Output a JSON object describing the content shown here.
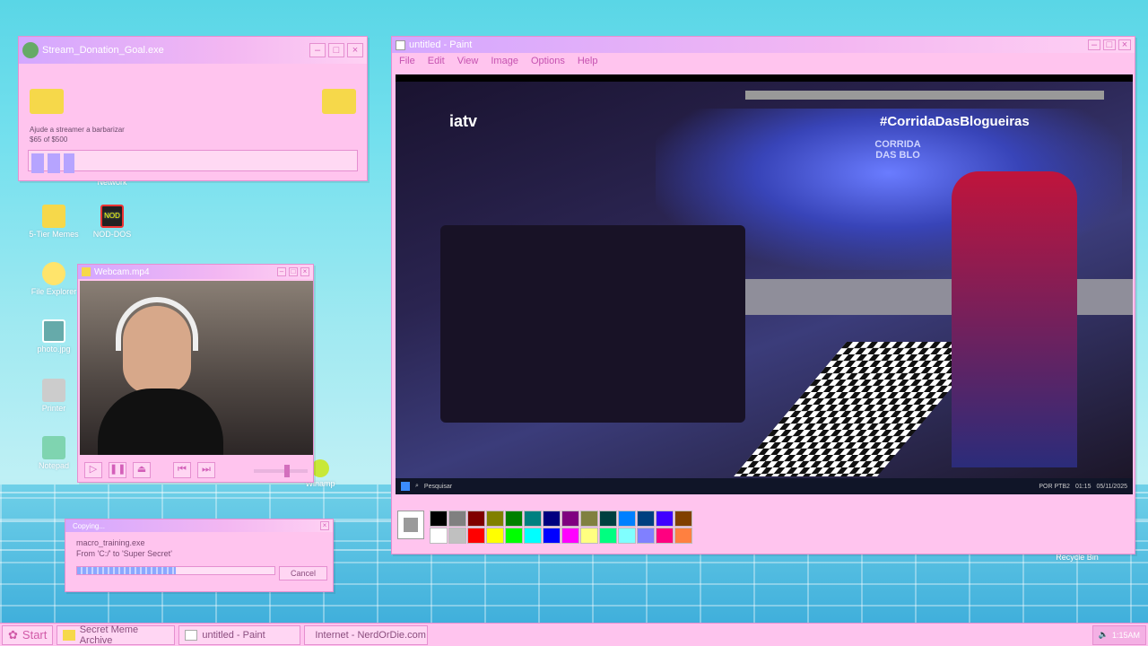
{
  "donation_window": {
    "title": "Stream_Donation_Goal.exe",
    "text": "Ajude a streamer a barbarizar",
    "amount": "$65 of $500",
    "progress": 0.13
  },
  "desktop_icons": [
    {
      "label": "Network",
      "icon": "network-icon"
    },
    {
      "label": "5-Tier Memes",
      "icon": "folder-icon"
    },
    {
      "label": "NOD-DOS",
      "icon": "nod-icon"
    },
    {
      "label": "File Explorer",
      "icon": "magnifier-icon"
    },
    {
      "label": "photo.jpg",
      "icon": "photo-icon"
    },
    {
      "label": "Printer",
      "icon": "printer-icon"
    },
    {
      "label": "Notepad",
      "icon": "notepad-icon"
    },
    {
      "label": "Winamp",
      "icon": "winamp-icon"
    },
    {
      "label": "Recycle Bin",
      "icon": "recycle-bin-icon"
    }
  ],
  "webcam_window": {
    "title": "Webcam.mp4",
    "controls": [
      "play",
      "pause",
      "eject",
      "previous",
      "next"
    ]
  },
  "copy_dialog": {
    "title": "Copying...",
    "file": "macro_training.exe",
    "from_to": "From 'C:/' to 'Super Secret'",
    "progress": 0.5,
    "cancel_label": "Cancel"
  },
  "paint_window": {
    "title": "untitled - Paint",
    "menu": [
      "File",
      "Edit",
      "View",
      "Image",
      "Options",
      "Help"
    ],
    "stream": {
      "channel_logo": "iatv",
      "hashtag": "#CorridaDasBlogueiras",
      "show_logo": "CORRIDA DAS BLO",
      "search_label": "Pesquisar",
      "clock_time": "01:15",
      "clock_date": "05/11/2025",
      "lang": "POR PTB2"
    },
    "palette_row1": [
      "#000000",
      "#808080",
      "#800000",
      "#808000",
      "#008000",
      "#008080",
      "#000080",
      "#800080",
      "#808040",
      "#004040",
      "#0080ff",
      "#004080",
      "#4000ff",
      "#804000"
    ],
    "palette_row2": [
      "#ffffff",
      "#c0c0c0",
      "#ff0000",
      "#ffff00",
      "#00ff00",
      "#00ffff",
      "#0000ff",
      "#ff00ff",
      "#ffff80",
      "#00ff80",
      "#80ffff",
      "#8080ff",
      "#ff0080",
      "#ff8040"
    ],
    "selected_color": "#9a9a9a"
  },
  "taskbar": {
    "start_label": "Start",
    "tasks": [
      {
        "label": "Secret Meme Archive",
        "icon": "folder-icon"
      },
      {
        "label": "untitled - Paint",
        "icon": "paint-icon"
      },
      {
        "label": "Internet - NerdOrDie.com",
        "icon": "internet-icon"
      }
    ],
    "time": "1:15AM"
  }
}
